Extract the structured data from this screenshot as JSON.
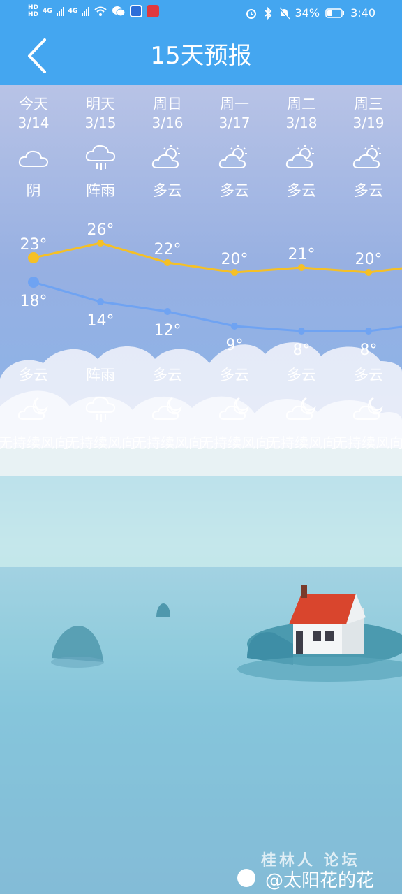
{
  "status_bar": {
    "left_badges": [
      "HD",
      "HD"
    ],
    "network_1": "4G",
    "network_2": "4G",
    "battery": "34%",
    "time": "3:40"
  },
  "header": {
    "title": "15天预报"
  },
  "days": [
    {
      "day": "今天",
      "date": "3/14",
      "day_weather": "阴",
      "day_icon": "cloudy-icon",
      "high": "23°",
      "low": "18°",
      "night_weather": "多云",
      "night_icon": "moon-cloud-icon",
      "wind": "无持续风向"
    },
    {
      "day": "明天",
      "date": "3/15",
      "day_weather": "阵雨",
      "day_icon": "rain-icon",
      "high": "26°",
      "low": "14°",
      "night_weather": "阵雨",
      "night_icon": "rain-icon",
      "wind": "无持续风向"
    },
    {
      "day": "周日",
      "date": "3/16",
      "day_weather": "多云",
      "day_icon": "sun-cloud-icon",
      "high": "22°",
      "low": "12°",
      "night_weather": "多云",
      "night_icon": "moon-cloud-icon",
      "wind": "无持续风向"
    },
    {
      "day": "周一",
      "date": "3/17",
      "day_weather": "多云",
      "day_icon": "sun-cloud-icon",
      "high": "20°",
      "low": "9°",
      "night_weather": "多云",
      "night_icon": "moon-cloud-icon",
      "wind": "无持续风向"
    },
    {
      "day": "周二",
      "date": "3/18",
      "day_weather": "多云",
      "day_icon": "sun-cloud-icon",
      "high": "21°",
      "low": "8°",
      "night_weather": "多云",
      "night_icon": "moon-cloud-icon",
      "wind": "无持续风向"
    },
    {
      "day": "周三",
      "date": "3/19",
      "day_weather": "多云",
      "day_icon": "sun-cloud-icon",
      "high": "20°",
      "low": "8°",
      "night_weather": "多云",
      "night_icon": "moon-cloud-icon",
      "wind": "无持续风向"
    }
  ],
  "chart_data": {
    "type": "line",
    "categories": [
      "3/14",
      "3/15",
      "3/16",
      "3/17",
      "3/18",
      "3/19"
    ],
    "series": [
      {
        "values": [
          23,
          26,
          22,
          20,
          21,
          20
        ],
        "color": "#f5c026"
      },
      {
        "values": [
          18,
          14,
          12,
          9,
          8,
          8
        ],
        "color": "#6fa3f2"
      }
    ]
  },
  "watermark": {
    "site": "桂林人 论坛",
    "handle": "@太阳花的花"
  },
  "colors": {
    "header_bg": "#44a6f0",
    "high_line": "#f5c026",
    "low_line": "#6fa3f2"
  }
}
